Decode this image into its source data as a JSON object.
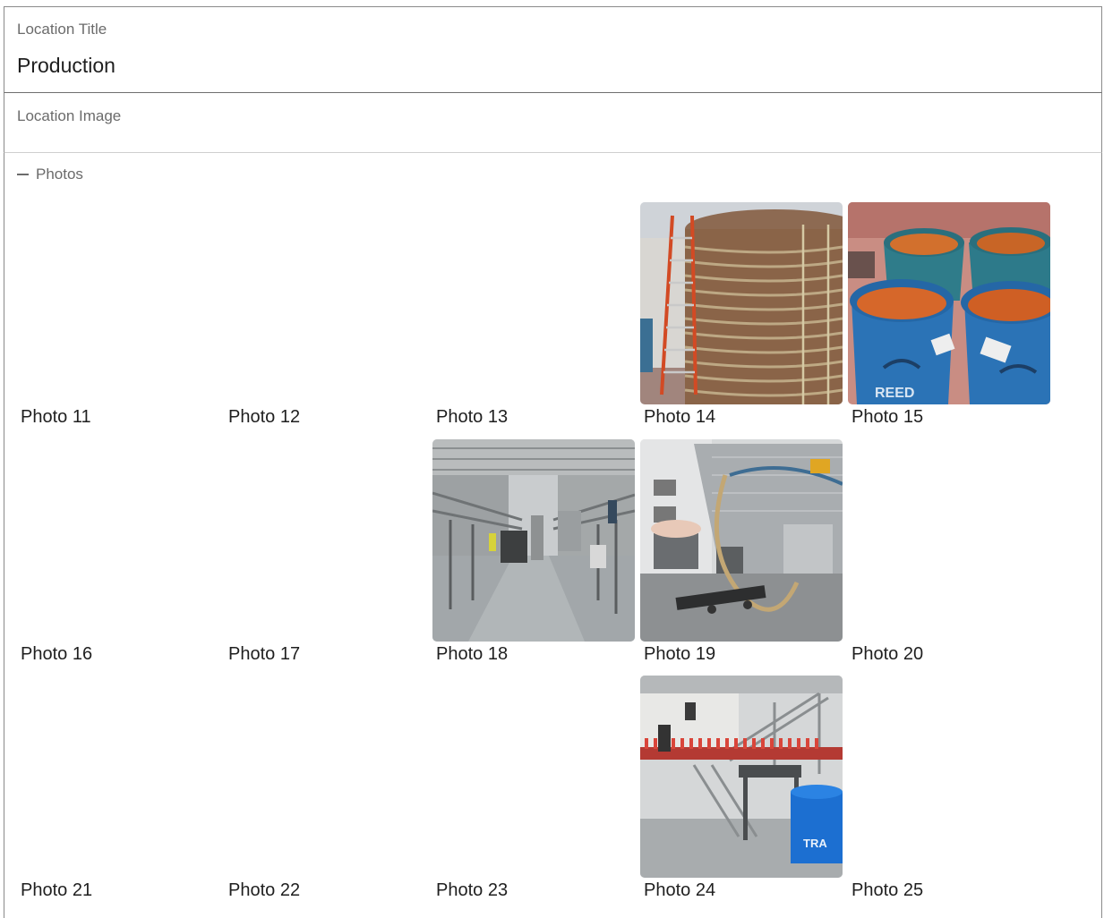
{
  "title_field": {
    "label": "Location Title",
    "value": "Production"
  },
  "image_field": {
    "label": "Location Image"
  },
  "photos": {
    "toggle_label": "Photos",
    "toggle_icon": "minus-icon",
    "items": [
      {
        "caption": "Photo 11",
        "has_image": false
      },
      {
        "caption": "Photo 12",
        "has_image": false
      },
      {
        "caption": "Photo 13",
        "has_image": false
      },
      {
        "caption": "Photo 14",
        "has_image": true,
        "subject": "copper tank with red ladder"
      },
      {
        "caption": "Photo 15",
        "has_image": true,
        "subject": "blue barrels of red spice"
      },
      {
        "caption": "Photo 16",
        "has_image": false
      },
      {
        "caption": "Photo 17",
        "has_image": false
      },
      {
        "caption": "Photo 18",
        "has_image": true,
        "subject": "factory aisle with conveyors"
      },
      {
        "caption": "Photo 19",
        "has_image": true,
        "subject": "stainless mixer with pump and hose"
      },
      {
        "caption": "Photo 20",
        "has_image": false
      },
      {
        "caption": "Photo 21",
        "has_image": false
      },
      {
        "caption": "Photo 22",
        "has_image": false
      },
      {
        "caption": "Photo 23",
        "has_image": false
      },
      {
        "caption": "Photo 24",
        "has_image": true,
        "subject": "bottling conveyor with blue trash can"
      },
      {
        "caption": "Photo 25",
        "has_image": false
      }
    ]
  },
  "colors": {
    "border": "#8a8a8a",
    "label": "#6b6b6b",
    "text": "#1f1f1f"
  }
}
